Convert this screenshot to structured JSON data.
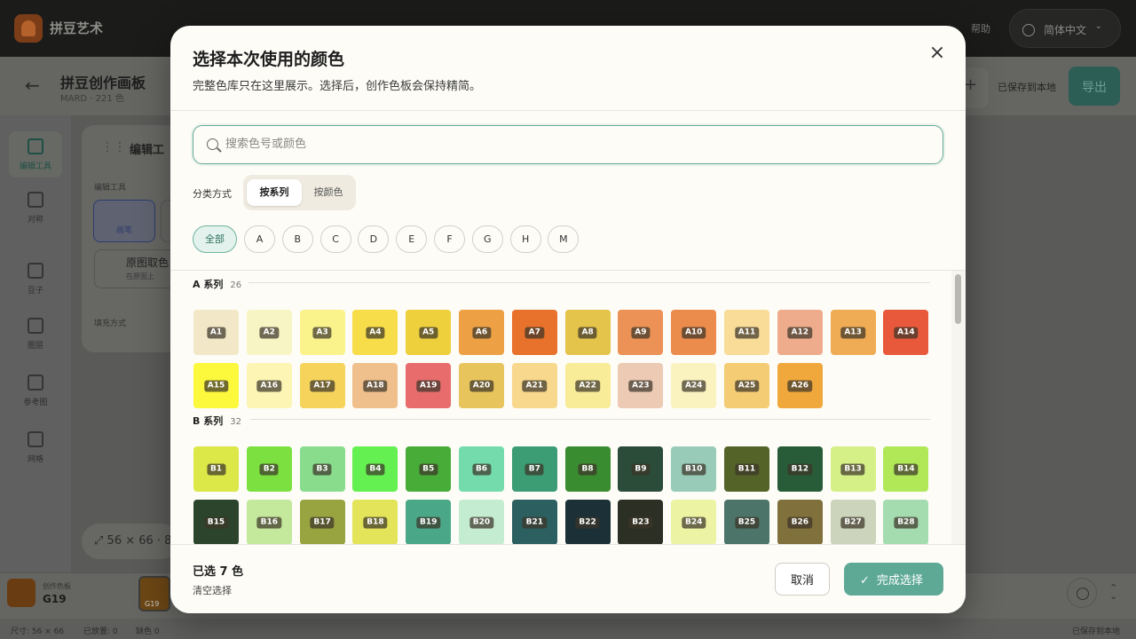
{
  "app": {
    "name": "拼豆艺术",
    "help": "帮助",
    "language": "简体中文"
  },
  "board": {
    "title": "拼豆创作画板",
    "meta": "MARD · 221 色",
    "saved_status": "已保存到本地",
    "export_label": "导出"
  },
  "rail": [
    {
      "label": "编辑工具",
      "icon": "brush-icon"
    },
    {
      "label": "对称",
      "icon": "symmetry-icon"
    },
    {
      "label": "豆子",
      "icon": "palette-icon"
    },
    {
      "label": "图层",
      "icon": "layers-icon"
    },
    {
      "label": "参考图",
      "icon": "image-icon"
    },
    {
      "label": "网格",
      "icon": "grid-icon"
    }
  ],
  "panel": {
    "title": "编辑工",
    "section_label": "编辑工具",
    "tool_label": "画笔",
    "pick_title": "原图取色",
    "pick_sub": "在原图上",
    "fill_label": "填充方式",
    "size": "56 × 66 · 8"
  },
  "bottom": {
    "current_label": "创作色板",
    "current_code": "G19",
    "chip_code": "G19",
    "status": [
      "尺寸: 56 × 66",
      "已放置: 0",
      "缺色 0"
    ],
    "saved": "已保存到本地"
  },
  "modal": {
    "title": "选择本次使用的颜色",
    "description": "完整色库只在这里展示。选择后，创作色板会保持精简。",
    "search_placeholder": "搜索色号或颜色",
    "sort_label": "分类方式",
    "sort_options": [
      "按系列",
      "按颜色"
    ],
    "filters": [
      "全部",
      "A",
      "B",
      "C",
      "D",
      "E",
      "F",
      "G",
      "H",
      "M"
    ],
    "selected_text": "已选 7 色",
    "clear_label": "清空选择",
    "cancel_label": "取消",
    "done_label": "完成选择",
    "series": [
      {
        "name": "A 系列",
        "count": "26",
        "colors": [
          {
            "code": "A1",
            "color": "#f2e8c8"
          },
          {
            "code": "A2",
            "color": "#f8f5c4"
          },
          {
            "code": "A3",
            "color": "#faf38c"
          },
          {
            "code": "A4",
            "color": "#f8dd4a"
          },
          {
            "code": "A5",
            "color": "#eecf3c"
          },
          {
            "code": "A6",
            "color": "#eea144"
          },
          {
            "code": "A7",
            "color": "#e8712c"
          },
          {
            "code": "A8",
            "color": "#e4c44a"
          },
          {
            "code": "A9",
            "color": "#ec9256"
          },
          {
            "code": "A10",
            "color": "#ec8c4c"
          },
          {
            "code": "A11",
            "color": "#f8dc98"
          },
          {
            "code": "A12",
            "color": "#eeac8c"
          },
          {
            "code": "A13",
            "color": "#f0ac54"
          },
          {
            "code": "A14",
            "color": "#e8583a"
          },
          {
            "code": "A15",
            "color": "#fcf83c"
          },
          {
            "code": "A16",
            "color": "#fcf5b4"
          },
          {
            "code": "A17",
            "color": "#f6d45c"
          },
          {
            "code": "A18",
            "color": "#f0c08c"
          },
          {
            "code": "A19",
            "color": "#e86c6c"
          },
          {
            "code": "A20",
            "color": "#e8c45c"
          },
          {
            "code": "A21",
            "color": "#f8d88c"
          },
          {
            "code": "A22",
            "color": "#f8ec98"
          },
          {
            "code": "A23",
            "color": "#eccab4"
          },
          {
            "code": "A24",
            "color": "#faf3c0"
          },
          {
            "code": "A25",
            "color": "#f4cc74"
          },
          {
            "code": "A26",
            "color": "#f0a83c"
          }
        ]
      },
      {
        "name": "B 系列",
        "count": "32",
        "colors": [
          {
            "code": "B1",
            "color": "#dce848"
          },
          {
            "code": "B2",
            "color": "#7ce040"
          },
          {
            "code": "B3",
            "color": "#88dc8c"
          },
          {
            "code": "B4",
            "color": "#64f050"
          },
          {
            "code": "B5",
            "color": "#48ac38"
          },
          {
            "code": "B6",
            "color": "#74dcac"
          },
          {
            "code": "B7",
            "color": "#3c9c74"
          },
          {
            "code": "B8",
            "color": "#3a8c30"
          },
          {
            "code": "B9",
            "color": "#2a4c38"
          },
          {
            "code": "B10",
            "color": "#98ccb8"
          },
          {
            "code": "B11",
            "color": "#546428"
          },
          {
            "code": "B12",
            "color": "#285c38"
          },
          {
            "code": "B13",
            "color": "#d6f088"
          },
          {
            "code": "B14",
            "color": "#b0e858"
          },
          {
            "code": "B15",
            "color": "#2c442c"
          },
          {
            "code": "B16",
            "color": "#c4e89c"
          },
          {
            "code": "B17",
            "color": "#98a440"
          },
          {
            "code": "B18",
            "color": "#e4e45a"
          },
          {
            "code": "B19",
            "color": "#4aa888"
          },
          {
            "code": "B20",
            "color": "#c4ecd0"
          },
          {
            "code": "B21",
            "color": "#2c6060"
          },
          {
            "code": "B22",
            "color": "#1c3038"
          },
          {
            "code": "B23",
            "color": "#2c3024"
          },
          {
            "code": "B24",
            "color": "#ecf4a4"
          },
          {
            "code": "B25",
            "color": "#4c7468"
          },
          {
            "code": "B26",
            "color": "#80703c"
          },
          {
            "code": "B27",
            "color": "#ccd4bc"
          },
          {
            "code": "B28",
            "color": "#a4dcb0"
          }
        ]
      }
    ]
  }
}
